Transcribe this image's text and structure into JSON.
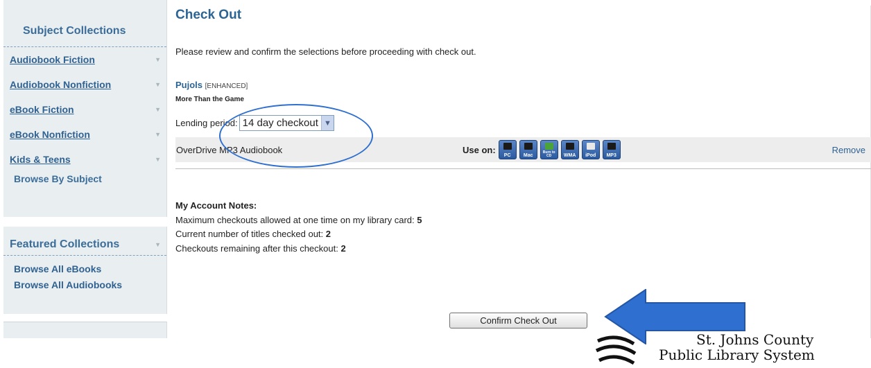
{
  "sidebar": {
    "subject_title": "Subject Collections",
    "subject_items": [
      {
        "label": "Audiobook Fiction"
      },
      {
        "label": "Audiobook Nonfiction"
      },
      {
        "label": "eBook Fiction"
      },
      {
        "label": "eBook Nonfiction"
      },
      {
        "label": "Kids & Teens"
      }
    ],
    "browse_by_subject": "Browse By Subject",
    "featured_title": "Featured Collections",
    "featured_items": [
      {
        "label": "Browse All eBooks"
      },
      {
        "label": "Browse All Audiobooks"
      }
    ]
  },
  "main": {
    "title": "Check Out",
    "intro": "Please review and confirm the selections before proceeding with check out.",
    "item_title": "Pujols",
    "item_tag": "[ENHANCED]",
    "item_subtitle": "More Than the Game",
    "lending_label": "Lending period:",
    "lending_value": "14 day checkout",
    "format_name": "OverDrive MP3 Audiobook",
    "use_on_label": "Use on:",
    "devices": [
      {
        "label": "PC",
        "icon": "pc-icon"
      },
      {
        "label": "Mac",
        "icon": "mac-icon"
      },
      {
        "label": "Burn to CD",
        "icon": "burn-to-cd-icon"
      },
      {
        "label": "WMA",
        "icon": "wma-player-icon"
      },
      {
        "label": "iPod",
        "icon": "ipod-icon"
      },
      {
        "label": "MP3",
        "icon": "mp3-player-icon"
      }
    ],
    "remove_label": "Remove",
    "notes_head": "My Account Notes:",
    "note_max_label": "Maximum checkouts allowed at one time on my library card:",
    "note_max_value": "5",
    "note_current_label": "Current number of titles checked out:",
    "note_current_value": "2",
    "note_remaining_label": "Checkouts remaining after this checkout:",
    "note_remaining_value": "2",
    "confirm_label": "Confirm Check Out"
  },
  "logo": {
    "line1": "St. Johns County",
    "line2": "Public Library System"
  },
  "colors": {
    "accent": "#2c6494",
    "annotation": "#2e6fcf"
  }
}
